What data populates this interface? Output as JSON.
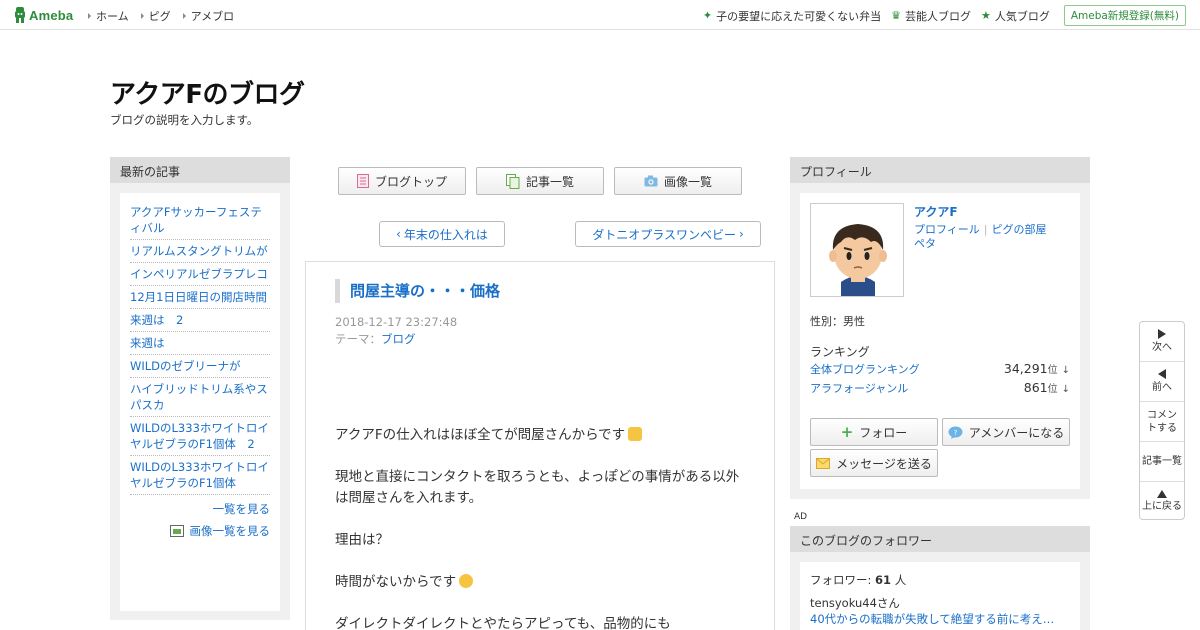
{
  "global_header": {
    "logo": "Ameba",
    "nav": [
      "ホーム",
      "ピグ",
      "アメブロ"
    ],
    "promos": [
      {
        "icon": "sparkle-icon",
        "label": "子の要望に応えた可愛くない弁当"
      },
      {
        "icon": "crown-icon",
        "label": "芸能人ブログ"
      },
      {
        "icon": "star-icon",
        "label": "人気ブログ"
      }
    ],
    "register": "Ameba新規登録(無料)"
  },
  "blog": {
    "title": "アクアFのブログ",
    "description": "ブログの説明を入力します。"
  },
  "left_sidebar": {
    "heading": "最新の記事",
    "items": [
      "アクアFサッカーフェスティバル",
      "リアルムスタングトリムが",
      "インペリアルゼブラプレコ",
      "12月1日日曜日の開店時間",
      "来週は　2",
      "来週は",
      "WILDのゼブリーナが",
      "ハイブリッドトリム系やスパスカ",
      "WILDのL333ホワイトロイヤルゼブラのF1個体　2",
      "WILDのL333ホワイトロイヤルゼブラのF1個体"
    ],
    "more_link": "一覧を見る",
    "images_link": "画像一覧を見る"
  },
  "center_nav": {
    "blog_top": "ブログトップ",
    "article_list": "記事一覧",
    "image_list": "画像一覧",
    "prev_article": "年末の仕入れは",
    "next_article": "ダトニオプラスワンベビー"
  },
  "article": {
    "title": "問屋主導の・・・価格",
    "date": "2018-12-17 23:27:48",
    "theme_label": "テーマ：",
    "theme": "ブログ",
    "paragraphs": [
      "アクアFの仕入れはほぼ全てが問屋さんからです",
      "現地と直接にコンタクトを取ろうとも、よっぽどの事情がある以外は問屋さんを入れます。",
      "理由は？",
      "時間がないからです",
      "ダイレクトダイレクトとやたらアピっても、品物的にも"
    ]
  },
  "profile": {
    "heading": "プロフィール",
    "name": "アクアF",
    "link_profile": "プロフィール",
    "link_pig_room": "ピグの部屋",
    "link_peta": "ペタ",
    "sex": "性別：男性",
    "ranking_heading": "ランキング",
    "rankings": [
      {
        "label": "全体ブログランキング",
        "value": "34,291",
        "unit": "位",
        "trend": "↓"
      },
      {
        "label": "アラフォージャンル",
        "value": "861",
        "unit": "位",
        "trend": "↓"
      }
    ],
    "follow": "フォロー",
    "amember": "アメンバーになる",
    "message": "メッセージを送る"
  },
  "ad_label": "AD",
  "followers": {
    "heading": "このブログのフォロワー",
    "count_label": "フォロワー: ",
    "count": "61",
    "count_unit": " 人",
    "user": "tensyoku44さん",
    "post_title": "40代からの転職が失敗して絶望する前に考え…"
  },
  "side_nav": {
    "next": "次へ",
    "prev": "前へ",
    "comment": "コメントする",
    "list": "記事一覧",
    "top": "上に戻る"
  },
  "colors": {
    "link": "#1a6fc9",
    "brand_green": "#2d8c3c",
    "panel_bg": "#f0f0f0",
    "panel_header": "#dddddd"
  }
}
